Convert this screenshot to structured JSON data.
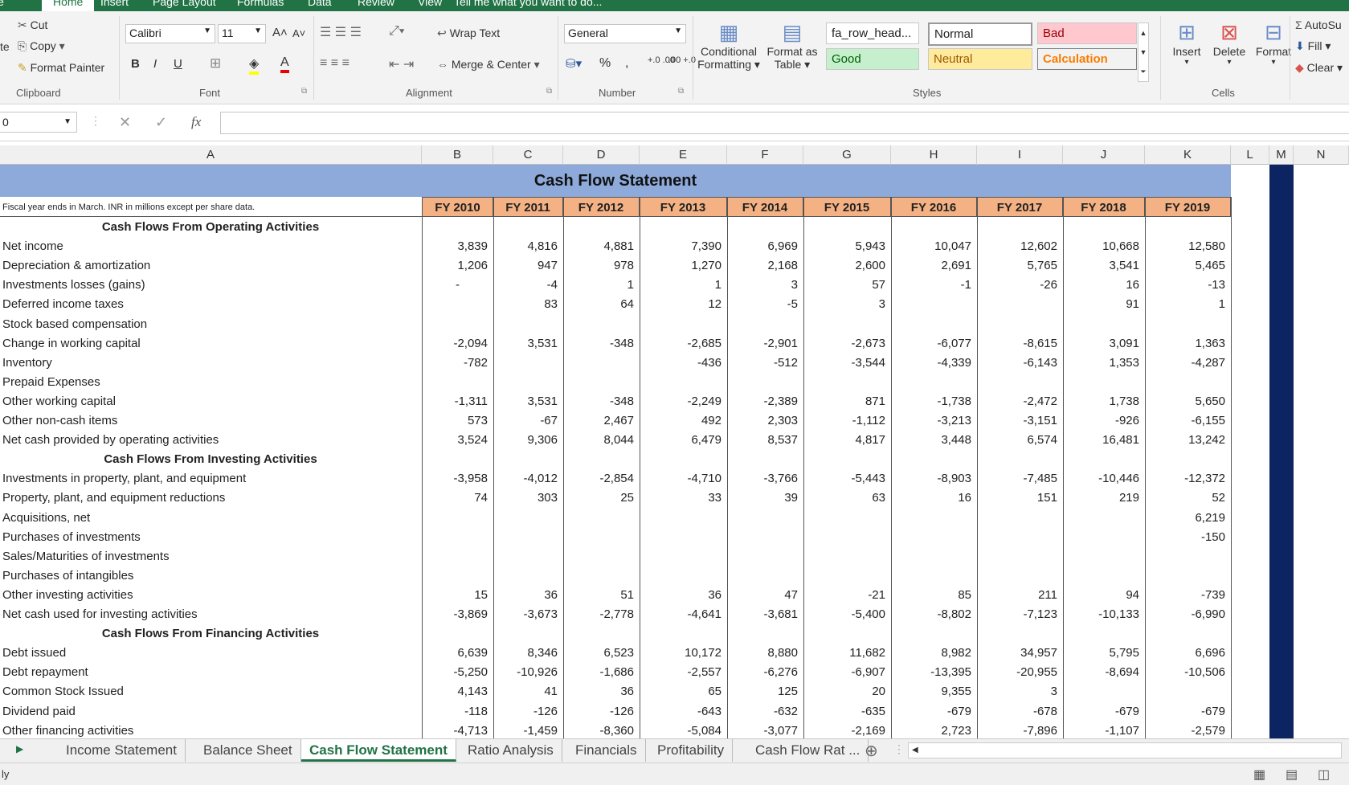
{
  "ribbon_tabs": [
    "le",
    "Home",
    "Insert",
    "Page Layout",
    "Formulas",
    "Data",
    "Review",
    "View",
    "Tell me what you want to do..."
  ],
  "clipboard": {
    "cut": "Cut",
    "copy": "Copy",
    "format_painter": "Format Painter",
    "paste_fragment": "te",
    "label": "Clipboard"
  },
  "font": {
    "name": "Calibri",
    "size": "11",
    "label": "Font",
    "bold": "B",
    "italic": "I",
    "underline": "U"
  },
  "alignment": {
    "wrap": "Wrap Text",
    "merge": "Merge & Center",
    "label": "Alignment"
  },
  "number": {
    "format": "General",
    "percent": "%",
    "comma": ",",
    "inc": "+.0 .00",
    "dec": ".00 +.0",
    "label": "Number"
  },
  "styles": {
    "cond": "Conditional Formatting",
    "cond1": "Conditional",
    "cond2": "Formatting",
    "table1": "Format as",
    "table2": "Table",
    "cells": [
      {
        "t": "fa_row_head...",
        "bg": "#ffffff",
        "fg": "#222222"
      },
      {
        "t": "Normal",
        "bg": "#ffffff",
        "fg": "#222222"
      },
      {
        "t": "Bad",
        "bg": "#ffc7ce",
        "fg": "#9c0006"
      },
      {
        "t": "Good",
        "bg": "#c6efce",
        "fg": "#006100"
      },
      {
        "t": "Neutral",
        "bg": "#ffeb9c",
        "fg": "#9c5700"
      },
      {
        "t": "Calculation",
        "bg": "#f2f2f2",
        "fg": "#fa7d00"
      }
    ],
    "label": "Styles"
  },
  "cells": {
    "insert": "Insert",
    "delete": "Delete",
    "format": "Format",
    "label": "Cells"
  },
  "editing": {
    "autosum": "AutoSu",
    "fill": "Fill",
    "clear": "Clear"
  },
  "namebox": "0",
  "fx": "fx",
  "columns": [
    "A",
    "B",
    "C",
    "D",
    "E",
    "F",
    "G",
    "H",
    "I",
    "J",
    "K",
    "L",
    "M",
    "N"
  ],
  "sheet": {
    "title": "Cash Flow Statement",
    "note": "Fiscal year ends in March. INR in millions except per share data.",
    "years": [
      "FY 2010",
      "FY 2011",
      "FY 2012",
      "FY 2013",
      "FY 2014",
      "FY 2015",
      "FY 2016",
      "FY 2017",
      "FY 2018",
      "FY 2019"
    ],
    "rows": [
      {
        "section": "Cash Flows From Operating Activities"
      },
      {
        "label": "Net income",
        "v": [
          "3,839",
          "4,816",
          "4,881",
          "7,390",
          "6,969",
          "5,943",
          "10,047",
          "12,602",
          "10,668",
          "12,580"
        ]
      },
      {
        "label": "Depreciation & amortization",
        "v": [
          "1,206",
          "947",
          "978",
          "1,270",
          "2,168",
          "2,600",
          "2,691",
          "5,765",
          "3,541",
          "5,465"
        ]
      },
      {
        "label": "Investments losses (gains)",
        "v": [
          "-",
          "-4",
          "1",
          "1",
          "3",
          "57",
          "-1",
          "-26",
          "16",
          "-13"
        ]
      },
      {
        "label": "Deferred income taxes",
        "v": [
          "",
          "83",
          "64",
          "12",
          "-5",
          "3",
          "",
          "",
          "91",
          "1"
        ]
      },
      {
        "label": "Stock based compensation",
        "v": [
          "",
          "",
          "",
          "",
          "",
          "",
          "",
          "",
          "",
          ""
        ]
      },
      {
        "label": "Change in working capital",
        "v": [
          "-2,094",
          "3,531",
          "-348",
          "-2,685",
          "-2,901",
          "-2,673",
          "-6,077",
          "-8,615",
          "3,091",
          "1,363"
        ]
      },
      {
        "label": "Inventory",
        "v": [
          "-782",
          "",
          "",
          "-436",
          "-512",
          "-3,544",
          "-4,339",
          "-6,143",
          "1,353",
          "-4,287"
        ]
      },
      {
        "label": "Prepaid Expenses",
        "v": [
          "",
          "",
          "",
          "",
          "",
          "",
          "",
          "",
          "",
          ""
        ]
      },
      {
        "label": "Other working capital",
        "v": [
          "-1,311",
          "3,531",
          "-348",
          "-2,249",
          "-2,389",
          "871",
          "-1,738",
          "-2,472",
          "1,738",
          "5,650"
        ]
      },
      {
        "label": "Other non-cash items",
        "v": [
          "573",
          "-67",
          "2,467",
          "492",
          "2,303",
          "-1,112",
          "-3,213",
          "-3,151",
          "-926",
          "-6,155"
        ]
      },
      {
        "label": "Net cash provided by operating activities",
        "v": [
          "3,524",
          "9,306",
          "8,044",
          "6,479",
          "8,537",
          "4,817",
          "3,448",
          "6,574",
          "16,481",
          "13,242"
        ]
      },
      {
        "section": "Cash Flows From Investing Activities"
      },
      {
        "label": "Investments in property, plant, and equipment",
        "v": [
          "-3,958",
          "-4,012",
          "-2,854",
          "-4,710",
          "-3,766",
          "-5,443",
          "-8,903",
          "-7,485",
          "-10,446",
          "-12,372"
        ]
      },
      {
        "label": "Property, plant, and equipment reductions",
        "v": [
          "74",
          "303",
          "25",
          "33",
          "39",
          "63",
          "16",
          "151",
          "219",
          "52"
        ]
      },
      {
        "label": "Acquisitions, net",
        "v": [
          "",
          "",
          "",
          "",
          "",
          "",
          "",
          "",
          "",
          "6,219"
        ]
      },
      {
        "label": "Purchases of investments",
        "v": [
          "",
          "",
          "",
          "",
          "",
          "",
          "",
          "",
          "",
          "-150"
        ]
      },
      {
        "label": "Sales/Maturities of investments",
        "v": [
          "",
          "",
          "",
          "",
          "",
          "",
          "",
          "",
          "",
          ""
        ]
      },
      {
        "label": "Purchases of intangibles",
        "v": [
          "",
          "",
          "",
          "",
          "",
          "",
          "",
          "",
          "",
          ""
        ]
      },
      {
        "label": "Other investing activities",
        "v": [
          "15",
          "36",
          "51",
          "36",
          "47",
          "-21",
          "85",
          "211",
          "94",
          "-739"
        ]
      },
      {
        "label": "Net cash used for investing activities",
        "v": [
          "-3,869",
          "-3,673",
          "-2,778",
          "-4,641",
          "-3,681",
          "-5,400",
          "-8,802",
          "-7,123",
          "-10,133",
          "-6,990"
        ]
      },
      {
        "section": "Cash Flows From Financing Activities"
      },
      {
        "label": "Debt issued",
        "v": [
          "6,639",
          "8,346",
          "6,523",
          "10,172",
          "8,880",
          "11,682",
          "8,982",
          "34,957",
          "5,795",
          "6,696"
        ]
      },
      {
        "label": "Debt repayment",
        "v": [
          "-5,250",
          "-10,926",
          "-1,686",
          "-2,557",
          "-6,276",
          "-6,907",
          "-13,395",
          "-20,955",
          "-8,694",
          "-10,506"
        ]
      },
      {
        "label": "Common Stock Issued",
        "v": [
          "4,143",
          "41",
          "36",
          "65",
          "125",
          "20",
          "9,355",
          "3",
          "",
          ""
        ]
      },
      {
        "label": "Dividend paid",
        "v": [
          "-118",
          "-126",
          "-126",
          "-643",
          "-632",
          "-635",
          "-679",
          "-678",
          "-679",
          "-679"
        ]
      },
      {
        "label": "Other financing activities",
        "v": [
          "-4,713",
          "-1,459",
          "-8,360",
          "-5,084",
          "-3,077",
          "-2,169",
          "2,723",
          "-7,896",
          "-1,107",
          "-2,579"
        ]
      }
    ]
  },
  "sheet_tabs": [
    "Income Statement",
    "Balance Sheet",
    "Cash Flow Statement",
    "Ratio Analysis",
    "Financials",
    "Profitability",
    "Cash Flow Rat ..."
  ],
  "status": "ly"
}
